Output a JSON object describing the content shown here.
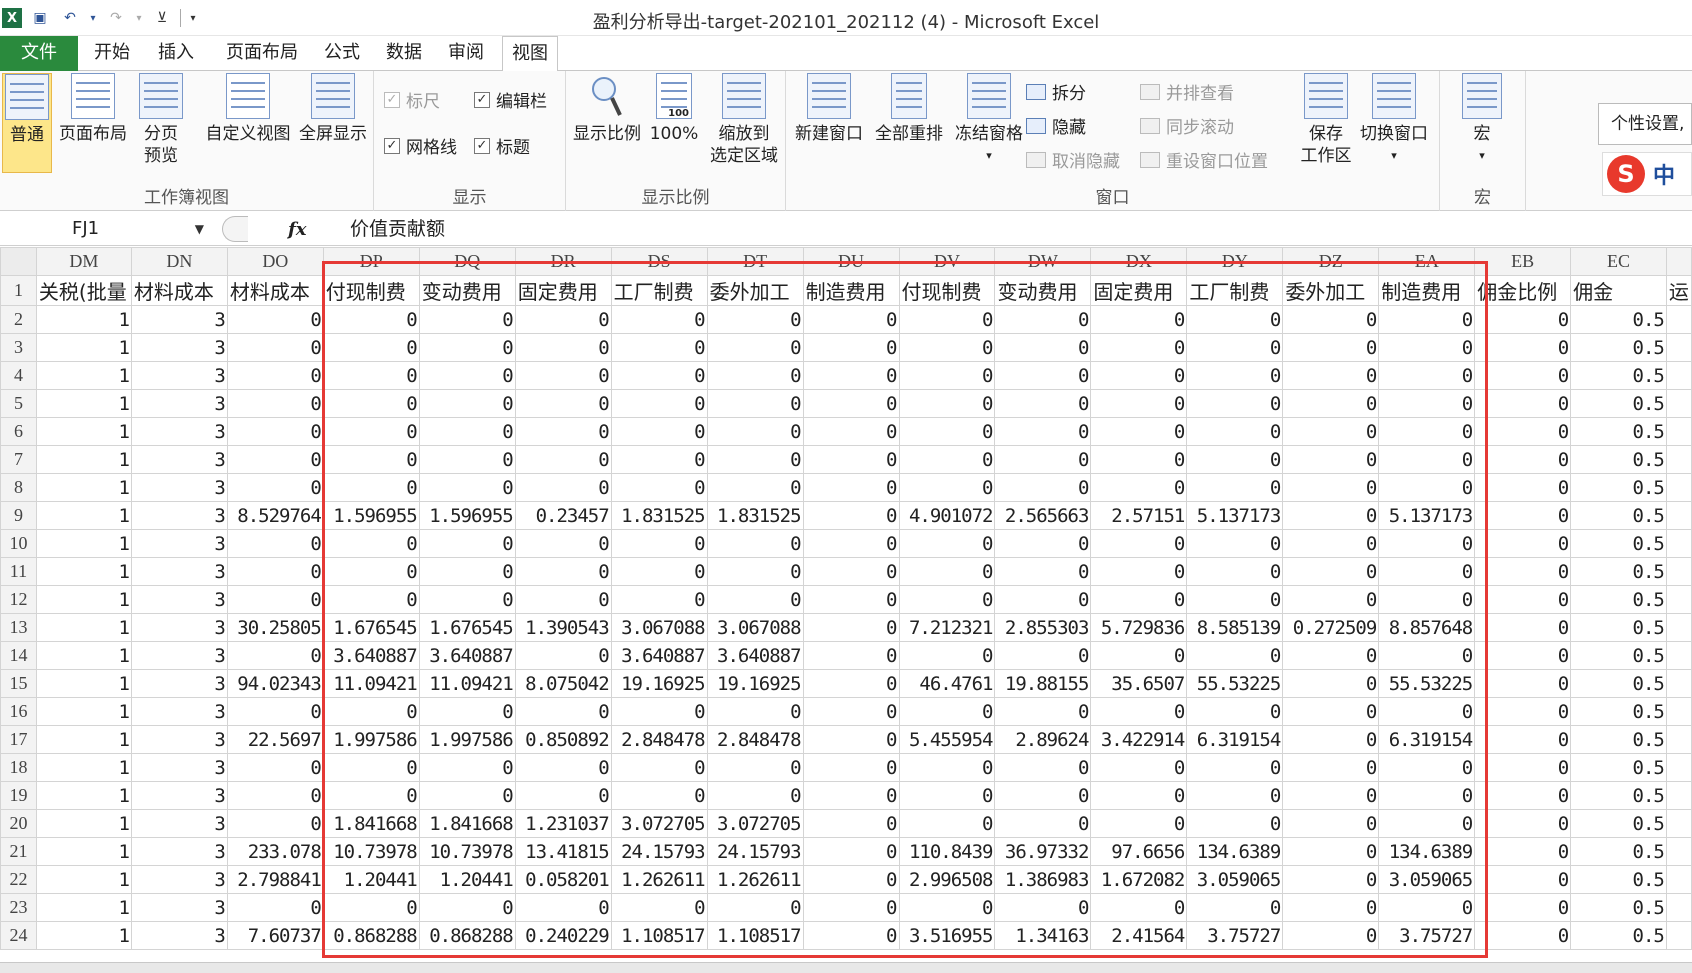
{
  "window": {
    "title": "盈利分析导出-target-202101_202112 (4)  -  Microsoft Excel"
  },
  "tabs": [
    "文件",
    "开始",
    "插入",
    "页面布局",
    "公式",
    "数据",
    "审阅",
    "视图"
  ],
  "active_tab": "视图",
  "ribbon": {
    "workbook_views": {
      "label": "工作簿视图",
      "normal": "普通",
      "page_layout": "页面布局",
      "page_break_1": "分页",
      "page_break_2": "预览",
      "custom_views": "自定义视图",
      "full_screen": "全屏显示"
    },
    "show": {
      "label": "显示",
      "ruler": "标尺",
      "formula_bar": "编辑栏",
      "gridlines": "网格线",
      "headings": "标题",
      "ruler_checked": "✓",
      "formula_bar_checked": "✓",
      "gridlines_checked": "✓",
      "headings_checked": "✓"
    },
    "zoom": {
      "label": "显示比例",
      "zoom": "显示比例",
      "hundred": "100%",
      "hundred_icon_text": "100",
      "zoom_to_sel_1": "缩放到",
      "zoom_to_sel_2": "选定区域"
    },
    "window": {
      "label": "窗口",
      "new_window": "新建窗口",
      "arrange_all": "全部重排",
      "freeze": "冻结窗格",
      "split": "拆分",
      "hide": "隐藏",
      "unhide": "取消隐藏",
      "side_by_side": "并排查看",
      "sync_scroll": "同步滚动",
      "reset_pos": "重设窗口位置",
      "save_ws_1": "保存",
      "save_ws_2": "工作区",
      "switch": "切换窗口"
    },
    "macros": {
      "label": "宏",
      "macros": "宏"
    },
    "tooltip": "个性设置,"
  },
  "ime": {
    "logo": "S",
    "text": "中"
  },
  "formula_bar": {
    "name_box": "FJ1",
    "fx": "fx",
    "formula": "价值贡献额"
  },
  "sheet": {
    "columns": [
      "DM",
      "DN",
      "DO",
      "DP",
      "DQ",
      "DR",
      "DS",
      "DT",
      "DU",
      "DV",
      "DW",
      "DX",
      "DY",
      "DZ",
      "EA",
      "EB",
      "EC"
    ],
    "header_row": [
      "关税(批量",
      "材料成本",
      "材料成本",
      "付现制费",
      "变动费用",
      "固定费用",
      "工厂制费",
      "委外加工",
      "制造费用",
      "付现制费",
      "变动费用",
      "固定费用",
      "工厂制费",
      "委外加工",
      "制造费用",
      "佣金比例",
      "佣金",
      "运"
    ],
    "rows": [
      {
        "n": "2",
        "v": [
          "1",
          "3",
          "0",
          "0",
          "0",
          "0",
          "0",
          "0",
          "0",
          "0",
          "0",
          "0",
          "0",
          "0",
          "0",
          "0",
          "0.5"
        ]
      },
      {
        "n": "3",
        "v": [
          "1",
          "3",
          "0",
          "0",
          "0",
          "0",
          "0",
          "0",
          "0",
          "0",
          "0",
          "0",
          "0",
          "0",
          "0",
          "0",
          "0.5"
        ]
      },
      {
        "n": "4",
        "v": [
          "1",
          "3",
          "0",
          "0",
          "0",
          "0",
          "0",
          "0",
          "0",
          "0",
          "0",
          "0",
          "0",
          "0",
          "0",
          "0",
          "0.5"
        ]
      },
      {
        "n": "5",
        "v": [
          "1",
          "3",
          "0",
          "0",
          "0",
          "0",
          "0",
          "0",
          "0",
          "0",
          "0",
          "0",
          "0",
          "0",
          "0",
          "0",
          "0.5"
        ]
      },
      {
        "n": "6",
        "v": [
          "1",
          "3",
          "0",
          "0",
          "0",
          "0",
          "0",
          "0",
          "0",
          "0",
          "0",
          "0",
          "0",
          "0",
          "0",
          "0",
          "0.5"
        ]
      },
      {
        "n": "7",
        "v": [
          "1",
          "3",
          "0",
          "0",
          "0",
          "0",
          "0",
          "0",
          "0",
          "0",
          "0",
          "0",
          "0",
          "0",
          "0",
          "0",
          "0.5"
        ]
      },
      {
        "n": "8",
        "v": [
          "1",
          "3",
          "0",
          "0",
          "0",
          "0",
          "0",
          "0",
          "0",
          "0",
          "0",
          "0",
          "0",
          "0",
          "0",
          "0",
          "0.5"
        ]
      },
      {
        "n": "9",
        "v": [
          "1",
          "3",
          "8.529764",
          "1.596955",
          "1.596955",
          "0.23457",
          "1.831525",
          "1.831525",
          "0",
          "4.901072",
          "2.565663",
          "2.57151",
          "5.137173",
          "0",
          "5.137173",
          "0",
          "0.5"
        ]
      },
      {
        "n": "10",
        "v": [
          "1",
          "3",
          "0",
          "0",
          "0",
          "0",
          "0",
          "0",
          "0",
          "0",
          "0",
          "0",
          "0",
          "0",
          "0",
          "0",
          "0.5"
        ]
      },
      {
        "n": "11",
        "v": [
          "1",
          "3",
          "0",
          "0",
          "0",
          "0",
          "0",
          "0",
          "0",
          "0",
          "0",
          "0",
          "0",
          "0",
          "0",
          "0",
          "0.5"
        ]
      },
      {
        "n": "12",
        "v": [
          "1",
          "3",
          "0",
          "0",
          "0",
          "0",
          "0",
          "0",
          "0",
          "0",
          "0",
          "0",
          "0",
          "0",
          "0",
          "0",
          "0.5"
        ]
      },
      {
        "n": "13",
        "v": [
          "1",
          "3",
          "30.25805",
          "1.676545",
          "1.676545",
          "1.390543",
          "3.067088",
          "3.067088",
          "0",
          "7.212321",
          "2.855303",
          "5.729836",
          "8.585139",
          "0.272509",
          "8.857648",
          "0",
          "0.5"
        ]
      },
      {
        "n": "14",
        "v": [
          "1",
          "3",
          "0",
          "3.640887",
          "3.640887",
          "0",
          "3.640887",
          "3.640887",
          "0",
          "0",
          "0",
          "0",
          "0",
          "0",
          "0",
          "0",
          "0.5"
        ]
      },
      {
        "n": "15",
        "v": [
          "1",
          "3",
          "94.02343",
          "11.09421",
          "11.09421",
          "8.075042",
          "19.16925",
          "19.16925",
          "0",
          "46.4761",
          "19.88155",
          "35.6507",
          "55.53225",
          "0",
          "55.53225",
          "0",
          "0.5"
        ]
      },
      {
        "n": "16",
        "v": [
          "1",
          "3",
          "0",
          "0",
          "0",
          "0",
          "0",
          "0",
          "0",
          "0",
          "0",
          "0",
          "0",
          "0",
          "0",
          "0",
          "0.5"
        ]
      },
      {
        "n": "17",
        "v": [
          "1",
          "3",
          "22.5697",
          "1.997586",
          "1.997586",
          "0.850892",
          "2.848478",
          "2.848478",
          "0",
          "5.455954",
          "2.89624",
          "3.422914",
          "6.319154",
          "0",
          "6.319154",
          "0",
          "0.5"
        ]
      },
      {
        "n": "18",
        "v": [
          "1",
          "3",
          "0",
          "0",
          "0",
          "0",
          "0",
          "0",
          "0",
          "0",
          "0",
          "0",
          "0",
          "0",
          "0",
          "0",
          "0.5"
        ]
      },
      {
        "n": "19",
        "v": [
          "1",
          "3",
          "0",
          "0",
          "0",
          "0",
          "0",
          "0",
          "0",
          "0",
          "0",
          "0",
          "0",
          "0",
          "0",
          "0",
          "0.5"
        ]
      },
      {
        "n": "20",
        "v": [
          "1",
          "3",
          "0",
          "1.841668",
          "1.841668",
          "1.231037",
          "3.072705",
          "3.072705",
          "0",
          "0",
          "0",
          "0",
          "0",
          "0",
          "0",
          "0",
          "0.5"
        ]
      },
      {
        "n": "21",
        "v": [
          "1",
          "3",
          "233.078",
          "10.73978",
          "10.73978",
          "13.41815",
          "24.15793",
          "24.15793",
          "0",
          "110.8439",
          "36.97332",
          "97.6656",
          "134.6389",
          "0",
          "134.6389",
          "0",
          "0.5"
        ]
      },
      {
        "n": "22",
        "v": [
          "1",
          "3",
          "2.798841",
          "1.20441",
          "1.20441",
          "0.058201",
          "1.262611",
          "1.262611",
          "0",
          "2.996508",
          "1.386983",
          "1.672082",
          "3.059065",
          "0",
          "3.059065",
          "0",
          "0.5"
        ]
      },
      {
        "n": "23",
        "v": [
          "1",
          "3",
          "0",
          "0",
          "0",
          "0",
          "0",
          "0",
          "0",
          "0",
          "0",
          "0",
          "0",
          "0",
          "0",
          "0",
          "0.5"
        ]
      },
      {
        "n": "24",
        "v": [
          "1",
          "3",
          "7.60737",
          "0.868288",
          "0.868288",
          "0.240229",
          "1.108517",
          "1.108517",
          "0",
          "3.516955",
          "1.34163",
          "2.41564",
          "3.75727",
          "0",
          "3.75727",
          "0",
          "0.5"
        ]
      }
    ]
  },
  "colors": {
    "file_tab": "#2a8a3d",
    "highlight_box": "#e53935",
    "active_view": "#fde68a"
  }
}
